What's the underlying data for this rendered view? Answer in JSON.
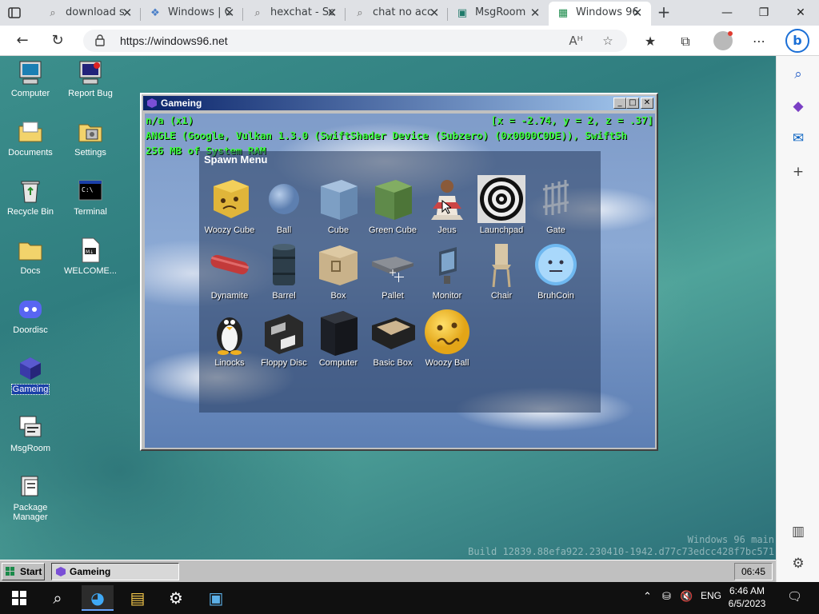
{
  "browser": {
    "tabs": [
      {
        "title": "download s",
        "icon": "search-icon"
      },
      {
        "title": "Windows | C",
        "icon": "puzzle-icon"
      },
      {
        "title": "hexchat - Sc",
        "icon": "search-icon"
      },
      {
        "title": "chat no acc",
        "icon": "search-icon"
      },
      {
        "title": "MsgRoom",
        "icon": "msgroom-icon"
      },
      {
        "title": "Windows 96",
        "icon": "windows96-icon"
      }
    ],
    "url": "https://windows96.net"
  },
  "desktop": {
    "icons": [
      {
        "label": "Computer"
      },
      {
        "label": "Report Bug"
      },
      {
        "label": "Documents"
      },
      {
        "label": "Settings"
      },
      {
        "label": "Recycle Bin"
      },
      {
        "label": "Terminal"
      },
      {
        "label": "Docs"
      },
      {
        "label": "WELCOME..."
      },
      {
        "label": "Doordisc"
      },
      {
        "label": "Gameing"
      },
      {
        "label": "MsgRoom"
      },
      {
        "label": "Package Manager"
      }
    ],
    "watermark_line1": "Windows 96 main",
    "watermark_line2": "Build 12839.88efa922.230410-1942.d77c73edcc428f7bc571"
  },
  "game_window": {
    "title": "Gameing",
    "debug_line1": "n/a (x1)",
    "coords": "[x = -2.74, y = 2, z = .37]",
    "debug_line2": "ANGLE (Google, Vulkan 1.3.0 (SwiftShader Device (Subzero) (0x0000C0DE)), SwiftSh",
    "debug_line3": "256 MB of System RAM",
    "spawn_menu": {
      "title": "Spawn Menu",
      "items": [
        {
          "name": "Woozy Cube"
        },
        {
          "name": "Ball"
        },
        {
          "name": "Cube"
        },
        {
          "name": "Green Cube"
        },
        {
          "name": "Jeus"
        },
        {
          "name": "Launchpad"
        },
        {
          "name": "Gate"
        },
        {
          "name": "Dynamite"
        },
        {
          "name": "Barrel"
        },
        {
          "name": "Box"
        },
        {
          "name": "Pallet"
        },
        {
          "name": "Monitor"
        },
        {
          "name": "Chair"
        },
        {
          "name": "BruhCoin"
        },
        {
          "name": "Linocks"
        },
        {
          "name": "Floppy Disc"
        },
        {
          "name": "Computer"
        },
        {
          "name": "Basic Box"
        },
        {
          "name": "Woozy Ball"
        }
      ]
    }
  },
  "w96_taskbar": {
    "start_label": "Start",
    "task_label": "Gameing",
    "clock": "06:45"
  },
  "win_taskbar": {
    "lang": "ENG",
    "time": "6:46 AM",
    "date": "6/5/2023"
  }
}
